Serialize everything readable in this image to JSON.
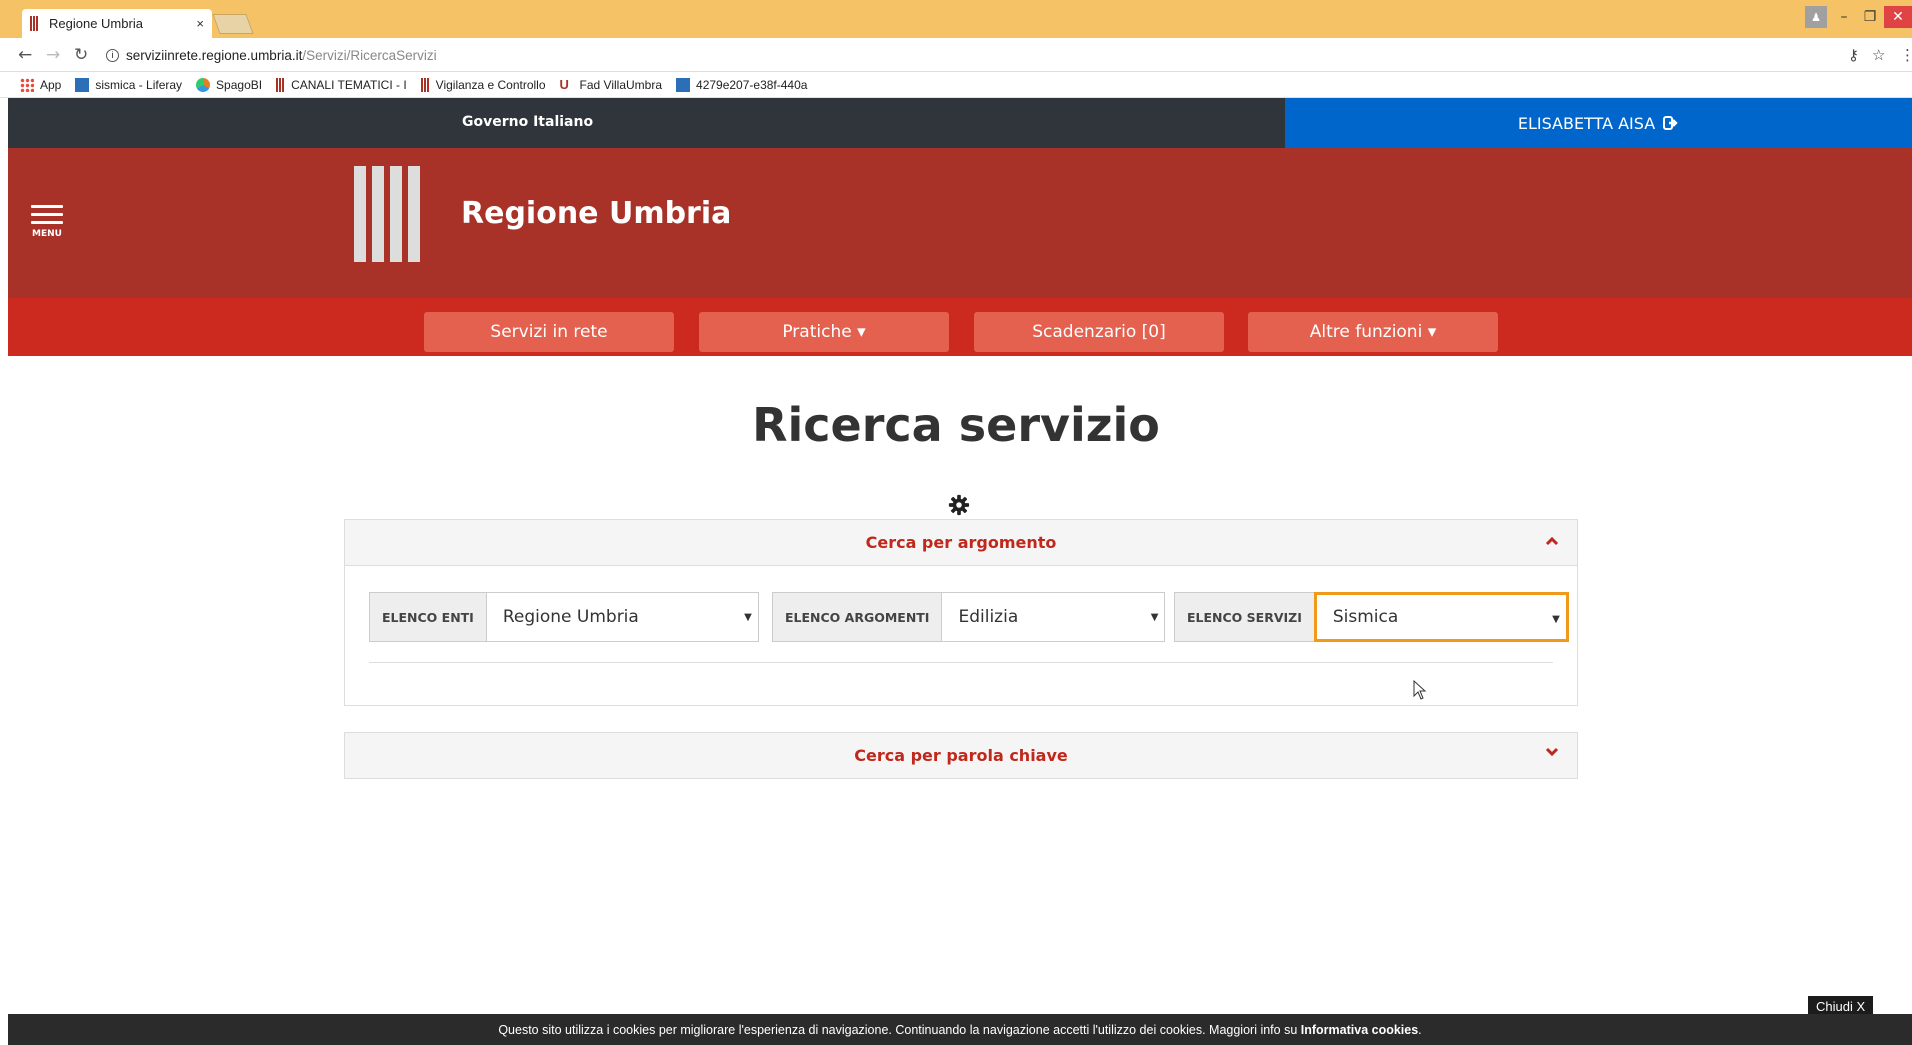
{
  "browser": {
    "tab_title": "Regione Umbria",
    "tab_close": "×",
    "url_host": "serviziinrete.regione.umbria.it",
    "url_path": "/Servizi/RicercaServizi",
    "bookmarks": [
      {
        "label": "App",
        "icon": "apps-grid-icon"
      },
      {
        "label": "sismica - Liferay",
        "icon": "liferay-icon"
      },
      {
        "label": "SpagoBI",
        "icon": "spagobi-icon"
      },
      {
        "label": "CANALI TEMATICI - I",
        "icon": "umbria-icon"
      },
      {
        "label": "Vigilanza e Controllo",
        "icon": "umbria-icon"
      },
      {
        "label": "Fad VillaUmbra",
        "icon": "villaumbra-icon"
      },
      {
        "label": "4279e207-e38f-440a",
        "icon": "liferay-icon"
      }
    ]
  },
  "site": {
    "gov_title": "Governo Italiano",
    "user_name": "ELISABETTA AISA",
    "menu_label": "MENU",
    "brand": "Regione Umbria",
    "nav": [
      {
        "label": "Servizi in rete"
      },
      {
        "label": "Pratiche ▾"
      },
      {
        "label": "Scadenzario [0]"
      },
      {
        "label": "Altre funzioni ▾"
      }
    ]
  },
  "main": {
    "page_title": "Ricerca servizio",
    "panel_argomento": {
      "title": "Cerca per argomento",
      "fields": [
        {
          "addon": "ELENCO ENTI",
          "value": "Regione Umbria"
        },
        {
          "addon": "ELENCO ARGOMENTI",
          "value": "Edilizia"
        },
        {
          "addon": "ELENCO SERVIZI",
          "value": "Sismica"
        }
      ]
    },
    "panel_parola": {
      "title": "Cerca per parola chiave"
    }
  },
  "cookie": {
    "text": "Questo sito utilizza i cookies per migliorare l'esperienza di navigazione. Continuando la navigazione accetti l'utilizzo dei cookies. Maggiori info su ",
    "link": "Informativa cookies",
    "end": ".",
    "close": "Chiudi X"
  },
  "colors": {
    "gov_bar": "#2f353b",
    "user_bar": "#0066cc",
    "header": "#a83228",
    "nav_bar": "#cc2a1e",
    "nav_button": "#e4604f",
    "accent": "#c0281c",
    "focus": "#f09a1a"
  }
}
